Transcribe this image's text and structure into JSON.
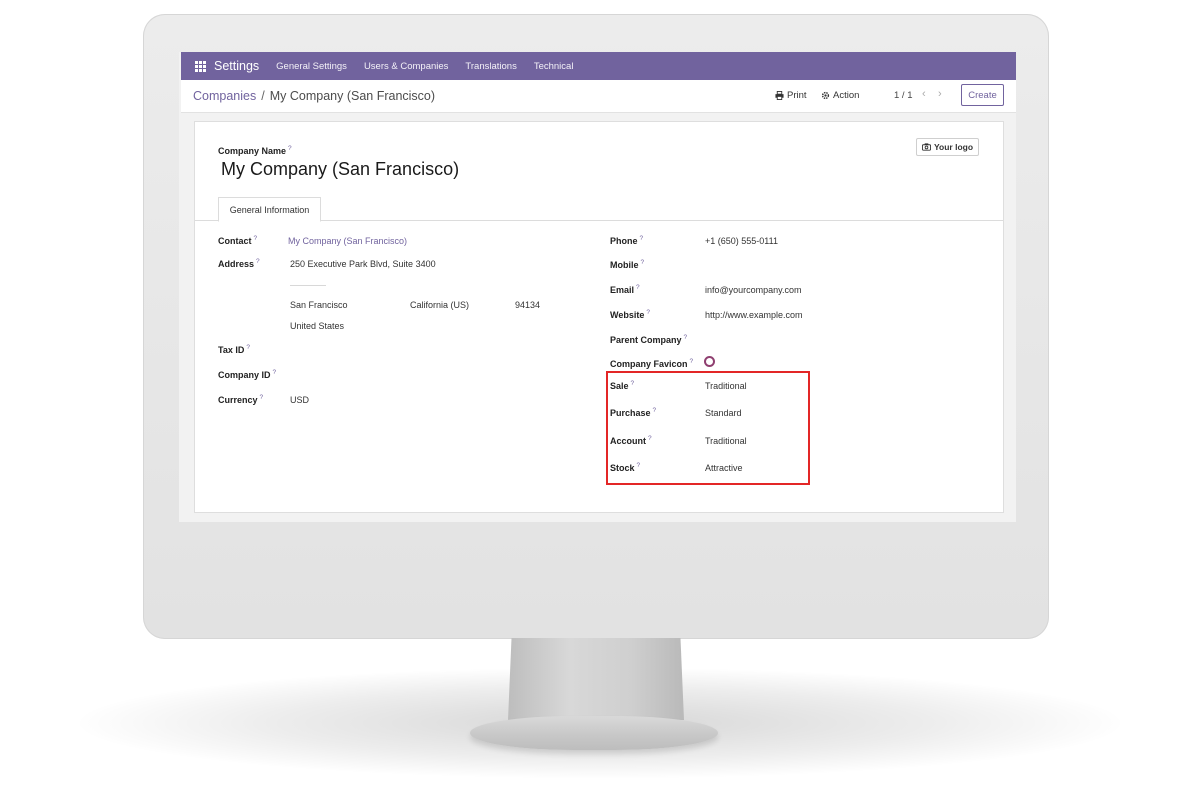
{
  "nav": {
    "brand": "Settings",
    "menu": [
      "General Settings",
      "Users & Companies",
      "Translations",
      "Technical"
    ]
  },
  "breadcrumb": {
    "parent": "Companies",
    "separator": "/",
    "current": "My Company (San Francisco)"
  },
  "toolbar": {
    "print_label": "Print",
    "action_label": "Action",
    "pager": "1 / 1",
    "prev": "‹",
    "next": "›",
    "create_label": "Create"
  },
  "form": {
    "company_name_label": "Company Name",
    "help_mark": "?",
    "company_name": "My Company (San Francisco)",
    "logo_button": "Your logo",
    "tab_label": "General Information",
    "left": {
      "contact_label": "Contact",
      "contact_value": "My Company (San Francisco)",
      "address_label": "Address",
      "street": "250 Executive Park Blvd, Suite 3400",
      "city": "San Francisco",
      "state": "California (US)",
      "zip": "94134",
      "country": "United States",
      "tax_id_label": "Tax ID",
      "company_id_label": "Company ID",
      "currency_label": "Currency",
      "currency_value": "USD"
    },
    "right": {
      "phone_label": "Phone",
      "phone_value": "+1 (650) 555-0111",
      "mobile_label": "Mobile",
      "email_label": "Email",
      "email_value": "info@yourcompany.com",
      "website_label": "Website",
      "website_value": "http://www.example.com",
      "parent_company_label": "Parent Company",
      "favicon_label": "Company Favicon",
      "sale_label": "Sale",
      "sale_value": "Traditional",
      "purchase_label": "Purchase",
      "purchase_value": "Standard",
      "account_label": "Account",
      "account_value": "Traditional",
      "stock_label": "Stock",
      "stock_value": "Attractive"
    }
  },
  "colors": {
    "brand_purple": "#71639e",
    "highlight_red": "#e32626",
    "favicon_ring": "#8f3f70"
  }
}
